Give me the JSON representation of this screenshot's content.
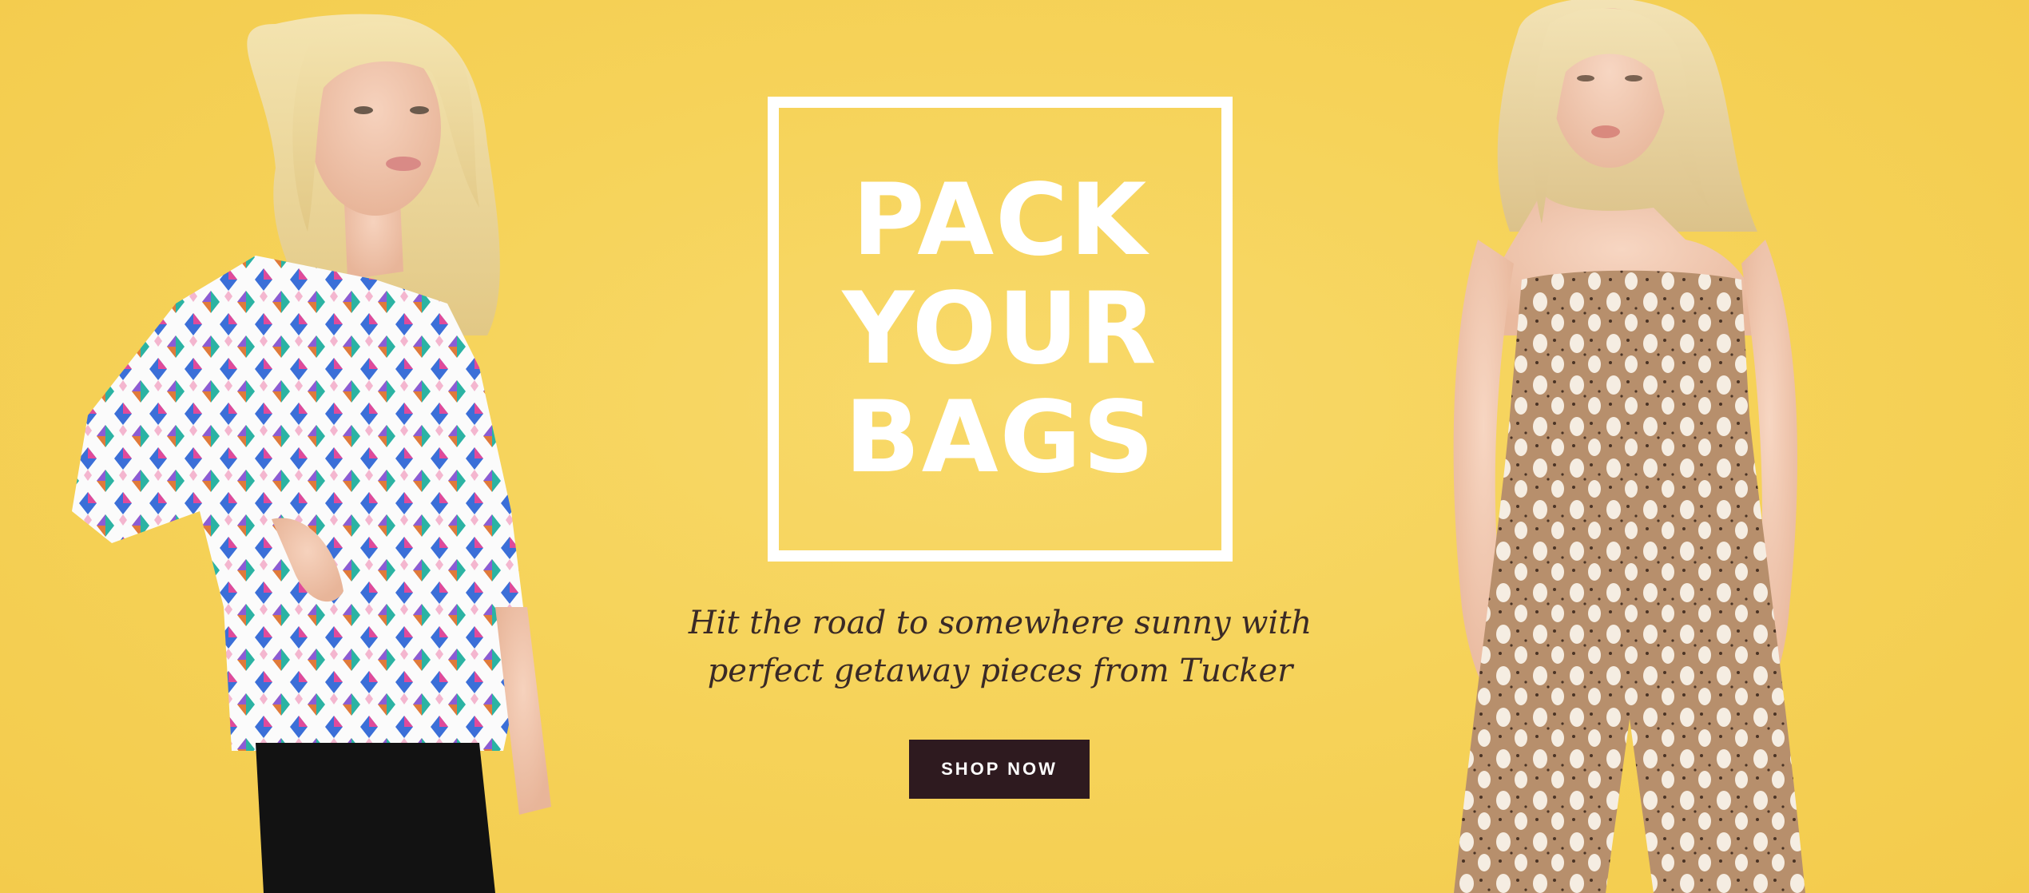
{
  "hero": {
    "headline": [
      "PACK",
      "YOUR",
      "BAGS"
    ],
    "subtitle": [
      "Hit the road to somewhere sunny with",
      "perfect getaway pieces from Tucker"
    ],
    "cta_label": "SHOP NOW"
  },
  "colors": {
    "background": "#f6d35a",
    "headline": "#ffffff",
    "subtitle": "#3a2a26",
    "cta_background": "#2e1a1f",
    "cta_text": "#ffffff"
  },
  "images": {
    "left": "model-left-geometric-print-blouse",
    "right": "model-right-spotted-strapless-jumpsuit"
  }
}
